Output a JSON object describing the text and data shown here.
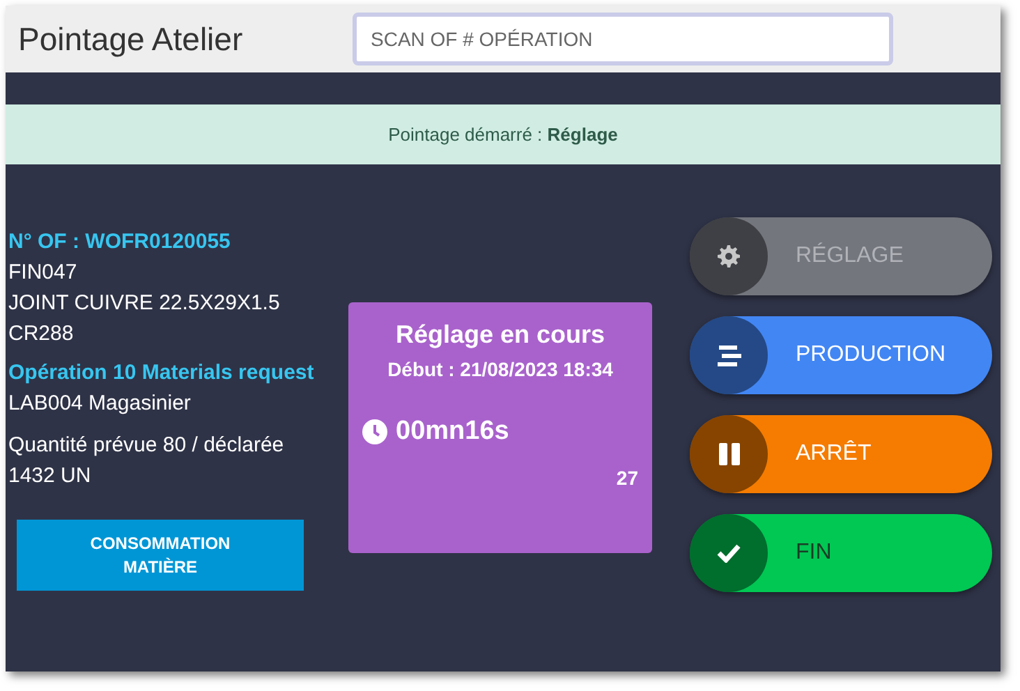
{
  "header": {
    "title": "Pointage Atelier",
    "search": {
      "placeholder": "SCAN OF # OPÉRATION"
    }
  },
  "banner": {
    "text": "Pointage démarré : **Réglage**"
  },
  "order": {
    "label": "N° OF : WOFR0120055",
    "lines": [
      "FIN047",
      "JOINT CUIVRE 22.5X29X1.5",
      "CR288"
    ],
    "operation": "Opération 10 Materials request",
    "operation_lines": [
      "LAB004 Magasinier"
    ],
    "quantity": "Quantité prévue 80 / déclarée 1432 UN",
    "button": "CONSOMMATION MATIÈRE"
  },
  "status_card": {
    "title": "Réglage en cours",
    "start": "Début : 21/08/2023 18:34",
    "duration": "00mn16s",
    "count": "27"
  },
  "actions": [
    {
      "label": "RÉGLAGE",
      "kind": "gear",
      "color": "#74767e",
      "disabled": true
    },
    {
      "label": "PRODUCTION",
      "kind": "bars",
      "color": "#4286f4",
      "disabled": false
    },
    {
      "label": "ARRÊT",
      "kind": "pause",
      "color": "#f57c00",
      "disabled": false
    },
    {
      "label": "FIN",
      "kind": "check",
      "color": "#00c853",
      "disabled": false
    }
  ]
}
